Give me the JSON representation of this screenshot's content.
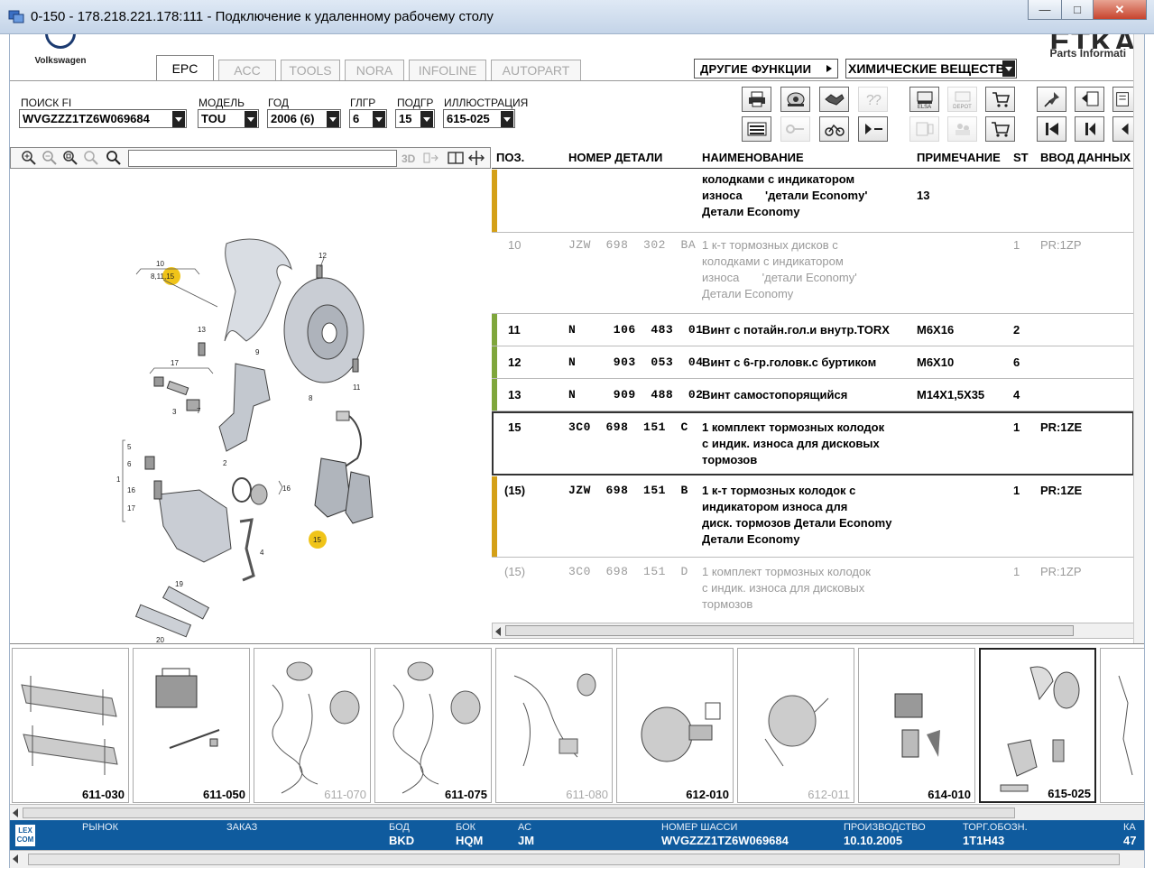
{
  "window": {
    "title": "0-150 - 178.218.221.178:111 - Подключение к удаленному рабочему столу"
  },
  "logo": {
    "brand": "Volkswagen"
  },
  "etka": {
    "big": "ETKA",
    "sub": "Parts Informati"
  },
  "tabs": [
    {
      "label": "EPC",
      "active": true
    },
    {
      "label": "ACC",
      "active": false
    },
    {
      "label": "TOOLS",
      "active": false
    },
    {
      "label": "NORA",
      "active": false
    },
    {
      "label": "INFOLINE",
      "active": false
    },
    {
      "label": "AUTOPART",
      "active": false
    }
  ],
  "functions": {
    "label": "ДРУГИЕ ФУНКЦИИ",
    "value": "ХИМИЧЕСКИЕ ВЕЩЕСТВА"
  },
  "filters": {
    "search_label": "ПОИСК FI",
    "search_value": "WVGZZZ1TZ6W069684",
    "model_label": "МОДЕЛЬ",
    "model_value": "TOU",
    "year_label": "ГОД",
    "year_value": "2006 (6)",
    "mg_label": "ГЛГР",
    "mg_value": "6",
    "sg_label": "ПОДГР",
    "sg_value": "15",
    "illus_label": "ИЛЛЮСТРАЦИЯ",
    "illus_value": "615-025"
  },
  "toolbar": {
    "elsa": "ELSA",
    "depot": "DEPOT"
  },
  "table": {
    "headers": {
      "pos": "ПОЗ.",
      "partno": "НОМЕР ДЕТАЛИ",
      "name": "НАИМЕНОВАНИЕ",
      "note": "ПРИМЕЧАНИЕ",
      "st": "ST",
      "data": "ВВОД ДАННЫХ"
    },
    "rows": [
      {
        "pos": "",
        "partno": "",
        "name": [
          "колодками с индикатором",
          "износа       'детали Economy'",
          "Детали Economy"
        ],
        "note": "13",
        "st": "",
        "data": "",
        "grey": false,
        "bar": "#d4a017"
      },
      {
        "pos": "10",
        "partno": "JZW  698  302  BA",
        "name": [
          "1 к-т тормозных дисков с",
          "колодками с индикатором",
          "износа       'детали Economy'",
          "Детали Economy"
        ],
        "note": "",
        "st": "1",
        "data": "PR:1ZP",
        "grey": true,
        "bar": ""
      },
      {
        "pos": "11",
        "partno": "N     106  483  01",
        "name": [
          "Винт с потайн.гол.и внутр.TORX"
        ],
        "note": "M6X16",
        "st": "2",
        "data": "",
        "grey": false,
        "bar": "#7fa63c"
      },
      {
        "pos": "12",
        "partno": "N     903  053  04",
        "name": [
          "Винт с 6-гр.головк.с буртиком"
        ],
        "note": "M6X10",
        "st": "6",
        "data": "",
        "grey": false,
        "bar": "#7fa63c"
      },
      {
        "pos": "13",
        "partno": "N     909  488  02",
        "name": [
          "Винт самостопорящийся"
        ],
        "note": "M14X1,5X35",
        "st": "4",
        "data": "",
        "grey": false,
        "bar": "#7fa63c"
      },
      {
        "pos": "15",
        "partno": "3C0  698  151  C",
        "name": [
          "1 комплект тормозных колодок",
          "с индик. износа для дисковых",
          "тормозов"
        ],
        "note": "",
        "st": "1",
        "data": "PR:1ZE",
        "grey": false,
        "bar": "#d4a017"
      },
      {
        "pos": "(15)",
        "partno": "JZW  698  151  B",
        "name": [
          "1 к-т тормозных колодок с",
          "индикатором износа для",
          "диск. тормозов Детали Economy",
          "Детали Economy"
        ],
        "note": "",
        "st": "1",
        "data": "PR:1ZE",
        "grey": false,
        "bar": "#d4a017"
      },
      {
        "pos": "(15)",
        "partno": "3C0  698  151  D",
        "name": [
          "1 комплект тормозных колодок",
          "с индик. износа для дисковых",
          "тормозов"
        ],
        "note": "",
        "st": "1",
        "data": "PR:1ZP",
        "grey": true,
        "bar": ""
      }
    ]
  },
  "diagram": {
    "labels": [
      "10",
      "8,11,15",
      "12",
      "13",
      "9",
      "17",
      "3",
      "7",
      "8",
      "11",
      "5",
      "6",
      "1",
      "16",
      "17",
      "2",
      "16",
      "4",
      "15",
      "19",
      "20"
    ]
  },
  "thumbnails": [
    {
      "num": "611-030",
      "grey": false,
      "sel": false
    },
    {
      "num": "611-050",
      "grey": false,
      "sel": false
    },
    {
      "num": "611-070",
      "grey": true,
      "sel": false
    },
    {
      "num": "611-075",
      "grey": false,
      "sel": false
    },
    {
      "num": "611-080",
      "grey": true,
      "sel": false
    },
    {
      "num": "612-010",
      "grey": false,
      "sel": false
    },
    {
      "num": "612-011",
      "grey": true,
      "sel": false
    },
    {
      "num": "614-010",
      "grey": false,
      "sel": false
    },
    {
      "num": "615-025",
      "grey": false,
      "sel": true
    }
  ],
  "status": {
    "lex": "LEX COM",
    "market_label": "РЫНОК",
    "order_label": "ЗАКАЗ",
    "bod_label": "БОД",
    "bod_value": "BKD",
    "bok_label": "БОК",
    "bok_value": "HQM",
    "ac_label": "АС",
    "ac_value": "JM",
    "chassis_label": "НОМЕР ШАССИ",
    "chassis_value": "WVGZZZ1TZ6W069684",
    "prod_label": "ПРОИЗВОДСТВО",
    "prod_value": "10.10.2005",
    "trade_label": "ТОРГ.ОБОЗН.",
    "trade_value": "1T1H43",
    "ka_label": "КА",
    "ka_value": "47"
  }
}
